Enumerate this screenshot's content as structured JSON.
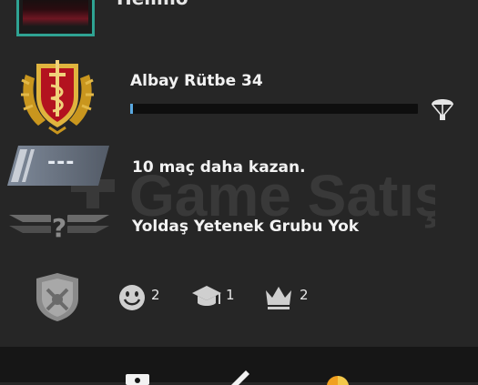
{
  "profile": {
    "name": "Hellmo"
  },
  "rank": {
    "title": "Albay Rütbe 34",
    "progress_fraction": 0.01
  },
  "matches": {
    "placeholder": "---",
    "text": "10 maç daha kazan."
  },
  "squad": {
    "text": "Yoldaş Yetenek Grubu Yok"
  },
  "stats": {
    "commendations": "2",
    "mentor": "1",
    "crowns": "2"
  },
  "watermark": {
    "text": "Game Satış"
  },
  "colors": {
    "accent_teal": "#2fa393",
    "progress_blue": "#5aa8e0",
    "background": "#262626",
    "bottom_bar": "#161616"
  },
  "icons": [
    "rank-emblem-icon",
    "parachute-icon",
    "unranked-badge-icon",
    "question-chevron-icon",
    "shield-emblem-icon",
    "smiley-icon",
    "graduation-cap-icon",
    "crown-icon",
    "profile-icon",
    "pencil-icon",
    "coin-icon"
  ]
}
